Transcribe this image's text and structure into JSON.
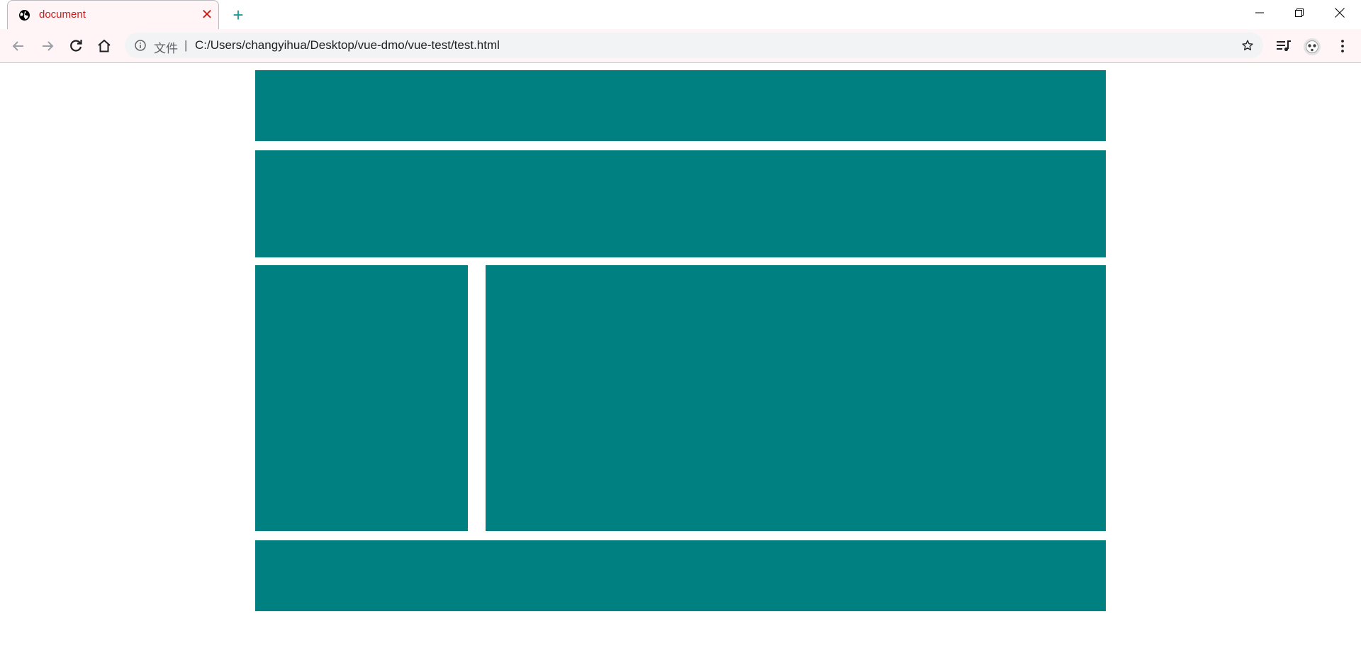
{
  "browser": {
    "tab": {
      "title": "document",
      "favicon_icon": "globe-icon",
      "close_glyph": "✕",
      "title_color": "#c5221f"
    },
    "new_tab_glyph": "+",
    "window_controls": [
      "minimize-icon",
      "restore-icon",
      "close-icon"
    ],
    "toolbar": {
      "nav_icons": [
        "back-arrow-icon",
        "forward-arrow-icon",
        "reload-icon",
        "home-icon"
      ],
      "omnibox": {
        "security_icon": "info-circle-icon",
        "scheme_chip": "文件",
        "separator": "|",
        "url": "C:/Users/changyihua/Desktop/vue-dmo/vue-test/test.html",
        "bookmark_icon": "star-outline-icon"
      },
      "right_icons": [
        "media-control-icon",
        "profile-avatar-icon",
        "kebab-menu-icon"
      ]
    }
  },
  "page": {
    "panel_color": "#008080",
    "panels": [
      "header-block",
      "nav-block",
      "aside-block",
      "main-block",
      "footer-block"
    ]
  }
}
